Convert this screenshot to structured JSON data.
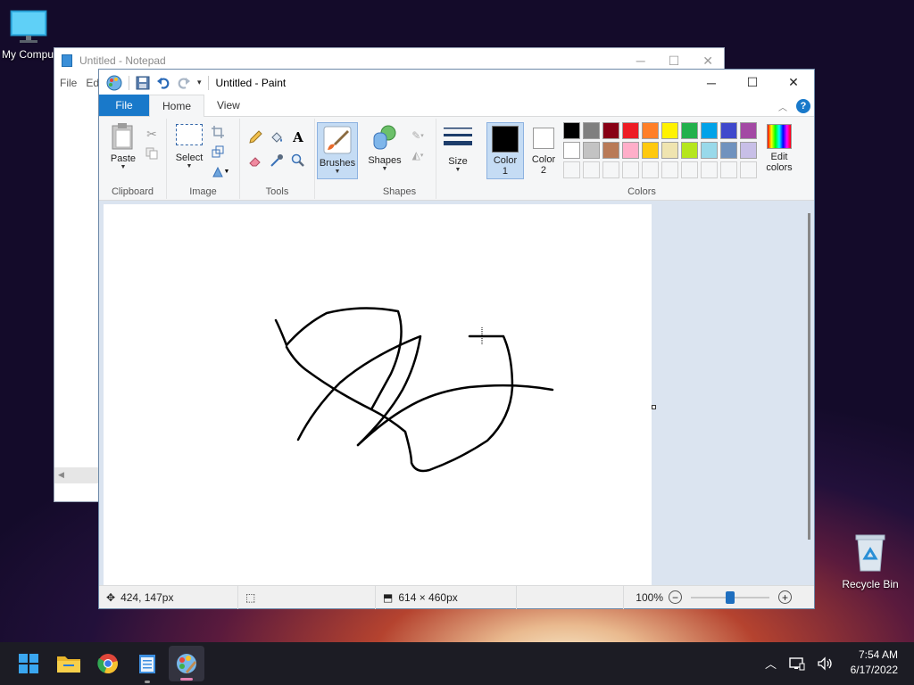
{
  "desktop": {
    "my_computer_label": "My Compu",
    "recycle_bin_label": "Recycle Bin"
  },
  "notepad": {
    "title": "Untitled - Notepad",
    "menu": [
      "File",
      "Ed"
    ]
  },
  "paint": {
    "title": "Untitled - Paint",
    "tabs": {
      "file": "File",
      "home": "Home",
      "view": "View"
    },
    "groups": {
      "clipboard": {
        "label": "Clipboard",
        "paste": "Paste"
      },
      "image": {
        "label": "Image",
        "select": "Select"
      },
      "tools": {
        "label": "Tools"
      },
      "brushes": {
        "label": "Brushes"
      },
      "shapes": {
        "label": "Shapes",
        "shapes_btn": "Shapes"
      },
      "size": {
        "label": "Size"
      },
      "colors": {
        "label": "Colors",
        "color1_line1": "Color",
        "color1_line2": "1",
        "color2_line1": "Color",
        "color2_line2": "2",
        "edit_line1": "Edit",
        "edit_line2": "colors",
        "palette_row1": [
          "#000000",
          "#7f7f7f",
          "#880015",
          "#ed1c24",
          "#ff7f27",
          "#fff200",
          "#22b14c",
          "#00a2e8",
          "#3f48cc",
          "#a349a4"
        ],
        "palette_row2": [
          "#ffffff",
          "#c3c3c3",
          "#b97a57",
          "#ffaec9",
          "#ffc90e",
          "#efe4b0",
          "#b5e61d",
          "#99d9ea",
          "#7092be",
          "#c8bfe7"
        ],
        "color1_value": "#000000",
        "color2_value": "#ffffff"
      }
    },
    "status": {
      "cursor_pos": "424, 147px",
      "selection_size": "",
      "canvas_size": "614 × 460px",
      "zoom": "100%",
      "zoom_level": 1.0
    }
  },
  "taskbar": {
    "time": "7:54 AM",
    "date": "6/17/2022",
    "apps": [
      "start-icon",
      "file-explorer-icon",
      "chrome-icon",
      "notepad-icon",
      "paint-icon"
    ]
  }
}
